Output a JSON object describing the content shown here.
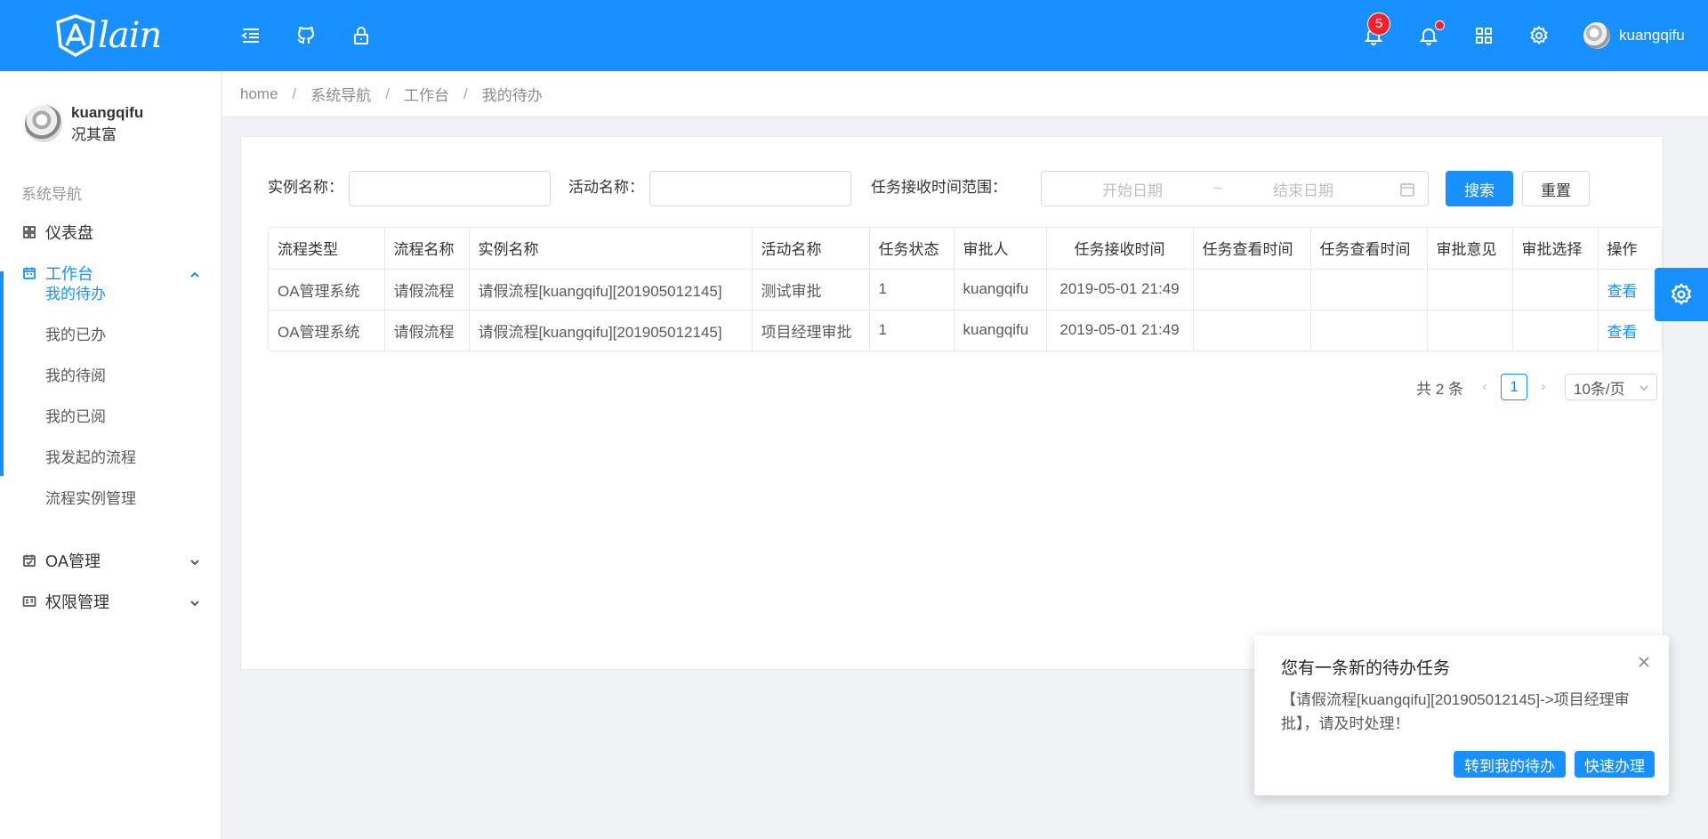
{
  "header": {
    "logo_text": "lain",
    "badge_count": "5",
    "username": "kuangqifu"
  },
  "sidebar": {
    "profile": {
      "name": "kuangqifu",
      "sub": "况其富"
    },
    "group_title": "系统导航",
    "items": [
      {
        "label": "仪表盘",
        "icon": "dashboard-icon"
      },
      {
        "label": "工作台",
        "icon": "calendar-icon",
        "open": true
      },
      {
        "label": "OA管理",
        "icon": "schedule-icon"
      },
      {
        "label": "权限管理",
        "icon": "idcard-icon"
      }
    ],
    "sub_items": [
      "我的待办",
      "我的已办",
      "我的待阅",
      "我的已阅",
      "我发起的流程",
      "流程实例管理"
    ]
  },
  "breadcrumb": [
    "home",
    "系统导航",
    "工作台",
    "我的待办"
  ],
  "filters": {
    "instance_label": "实例名称：",
    "activity_label": "活动名称：",
    "range_label": "任务接收时间范围：",
    "start_placeholder": "开始日期",
    "range_sep": "~",
    "end_placeholder": "结束日期",
    "search_button": "搜索",
    "reset_button": "重置"
  },
  "table": {
    "columns": [
      "流程类型",
      "流程名称",
      "实例名称",
      "活动名称",
      "任务状态",
      "审批人",
      "任务接收时间",
      "任务查看时间",
      "任务查看时间",
      "审批意见",
      "审批选择",
      "操作"
    ],
    "rows": [
      [
        "OA管理系统",
        "请假流程",
        "请假流程[kuangqifu][201905012145]",
        "测试审批",
        "1",
        "kuangqifu",
        "2019-05-01 21:49",
        "",
        "",
        "",
        "",
        "查看"
      ],
      [
        "OA管理系统",
        "请假流程",
        "请假流程[kuangqifu][201905012145]",
        "项目经理审批",
        "1",
        "kuangqifu",
        "2019-05-01 21:49",
        "",
        "",
        "",
        "",
        "查看"
      ]
    ]
  },
  "pagination": {
    "total": "共 2 条",
    "current": "1",
    "page_size": "10条/页"
  },
  "notification": {
    "title": "您有一条新的待办任务",
    "body": "【请假流程[kuangqifu][201905012145]->项目经理审批】，请及时处理！",
    "btn_goto": "转到我的待办",
    "btn_quick": "快速办理"
  },
  "colors": {
    "primary": "#1890ff",
    "danger": "#f5222d"
  }
}
